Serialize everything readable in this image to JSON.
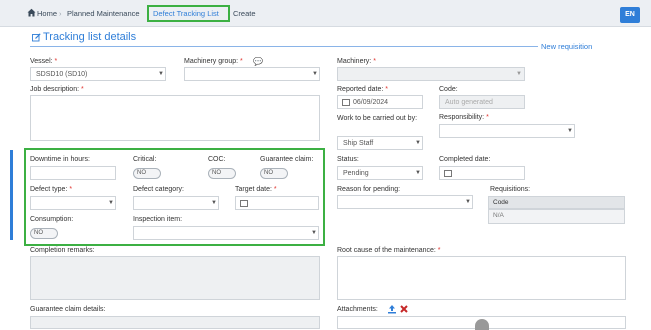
{
  "breadcrumb": {
    "home": "Home",
    "planned": "Planned Maintenance",
    "defect": "Defect Tracking List",
    "create": "Create"
  },
  "lang": "EN",
  "header": {
    "title": "Tracking list details",
    "new_requisition": "New requisition"
  },
  "form": {
    "vessel_label": "Vessel:",
    "vessel_value": "SDSD10 (SD10)",
    "machinery_group_label": "Machinery group:",
    "machinery_label": "Machinery:",
    "job_description_label": "Job description:",
    "reported_date_label": "Reported date:",
    "reported_date_value": "06/09/2024",
    "code_label": "Code:",
    "code_placeholder": "Auto generated",
    "work_label": "Work to be carried out by:",
    "work_value": "Ship Staff",
    "responsibility_label": "Responsibility:",
    "downtime_label": "Downtime in hours:",
    "critical_label": "Critical:",
    "coc_label": "COC:",
    "guarantee_label": "Guarantee claim:",
    "toggle_no": "NO",
    "status_label": "Status:",
    "status_value": "Pending",
    "completed_label": "Completed date:",
    "defect_type_label": "Defect type:",
    "defect_category_label": "Defect category:",
    "target_date_label": "Target date:",
    "reason_label": "Reason for pending:",
    "requisitions_label": "Requisitions:",
    "req_code_header": "Code",
    "req_code_value": "N/A",
    "consumption_label": "Consumption:",
    "inspection_label": "Inspection item:",
    "completion_label": "Completion remarks:",
    "root_cause_label": "Root cause of the maintenance:",
    "guarantee_details_label": "Guarantee claim details:",
    "attachments_label": "Attachments:",
    "required_mark": "*"
  },
  "colors": {
    "accent": "#2f7ed8",
    "highlight": "#3cb043",
    "required": "#e0322d"
  }
}
